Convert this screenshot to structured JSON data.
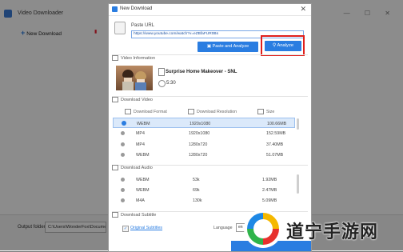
{
  "background_app": {
    "title": "Video Downloader",
    "new_download": "New Download",
    "output_folder_label": "Output folder:",
    "output_folder_value": "C:\\Users\\WonderFox\\Documents\\"
  },
  "dialog": {
    "title": "New Download",
    "url_label": "Paste URL",
    "url_value": "https://www.youtube.com/watch?v=eZBfaFUR0Bs",
    "paste_analyze_button": "Paste and Analyze",
    "analyze_button": "Analyze",
    "video_info": {
      "section": "Video Information",
      "title": "Surprise Home Makeover - SNL",
      "duration": "5:30"
    },
    "download_video": {
      "section": "Download Video",
      "headers": [
        "Download Format",
        "Download Resolution",
        "Size"
      ],
      "rows": [
        {
          "format": "WEBM",
          "resolution": "1920x1080",
          "size": "100.66MB",
          "selected": true
        },
        {
          "format": "MP4",
          "resolution": "1920x1080",
          "size": "152.59MB",
          "selected": false
        },
        {
          "format": "MP4",
          "resolution": "1280x720",
          "size": "37.40MB",
          "selected": false
        },
        {
          "format": "WEBM",
          "resolution": "1280x720",
          "size": "51.07MB",
          "selected": false
        }
      ]
    },
    "download_audio": {
      "section": "Download Audio",
      "rows": [
        {
          "format": "WEBM",
          "bitrate": "53k",
          "size": "1.92MB"
        },
        {
          "format": "WEBM",
          "bitrate": "69k",
          "size": "2.47MB"
        },
        {
          "format": "M4A",
          "bitrate": "130k",
          "size": "5.09MB"
        }
      ]
    },
    "download_subtitle": {
      "section": "Download Subtitle",
      "original_subtitles": "Original Subtitles",
      "language_label": "Language",
      "language_value": "en"
    }
  },
  "watermark": {
    "text": "道宁手游网"
  },
  "colors": {
    "accent": "#2a7de1",
    "highlight": "#e0201b"
  }
}
